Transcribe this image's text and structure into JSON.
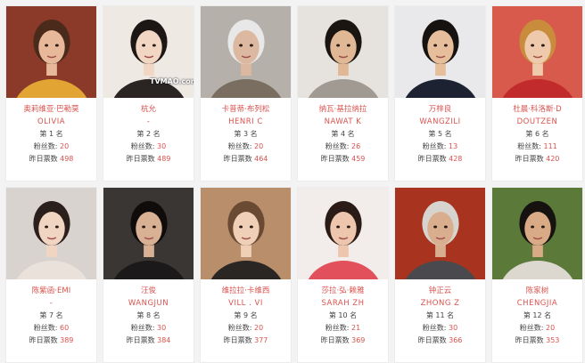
{
  "cards": [
    {
      "name_cn": "奥莉维亚·巴勒莫",
      "name_en": "OLIVIA",
      "rank": "第 1 名",
      "fans_label": "粉丝数:",
      "fans": "20",
      "votes_label": "昨日票数",
      "votes": "498",
      "palette": {
        "bg": "#8b3a2a",
        "skin": "#e7b89a",
        "hair": "#4a2a1a",
        "cloth": "#e2a534"
      }
    },
    {
      "name_cn": "杭允",
      "name_en": "-",
      "rank": "第 2 名",
      "fans_label": "粉丝数:",
      "fans": "30",
      "votes_label": "昨日票数",
      "votes": "489",
      "watermark": "TVMAO.com",
      "palette": {
        "bg": "#efe9e4",
        "skin": "#f2d6c4",
        "hair": "#1c1714",
        "cloth": "#2a2523"
      }
    },
    {
      "name_cn": "卡普蒂·布列松",
      "name_en": "HENRI C",
      "rank": "第 3 名",
      "fans_label": "粉丝数:",
      "fans": "20",
      "votes_label": "昨日票数",
      "votes": "464",
      "palette": {
        "bg": "#b5b1aa",
        "skin": "#dcb8a0",
        "hair": "#e8e8e8",
        "cloth": "#7a6e60"
      }
    },
    {
      "name_cn": "纳瓦·基拉纳拉",
      "name_en": "NAWAT K",
      "rank": "第 4 名",
      "fans_label": "粉丝数:",
      "fans": "26",
      "votes_label": "昨日票数",
      "votes": "459",
      "palette": {
        "bg": "#e6e2dd",
        "skin": "#e0b895",
        "hair": "#1b1512",
        "cloth": "#a09a93"
      }
    },
    {
      "name_cn": "万梓良",
      "name_en": "WANGZILI",
      "rank": "第 5 名",
      "fans_label": "粉丝数:",
      "fans": "13",
      "votes_label": "昨日票数",
      "votes": "428",
      "palette": {
        "bg": "#e9e9ec",
        "skin": "#e6be9c",
        "hair": "#15120f",
        "cloth": "#1d2233"
      }
    },
    {
      "name_cn": "杜晨·科洛斯·D",
      "name_en": "DOUTZEN",
      "rank": "第 6 名",
      "fans_label": "粉丝数:",
      "fans": "111",
      "votes_label": "昨日票数",
      "votes": "420",
      "palette": {
        "bg": "#d85a4d",
        "skin": "#efc9ab",
        "hair": "#c98c3c",
        "cloth": "#c22b2b"
      }
    },
    {
      "name_cn": "陈紫函·EMI",
      "name_en": "-",
      "rank": "第 7 名",
      "fans_label": "粉丝数:",
      "fans": "60",
      "votes_label": "昨日票数",
      "votes": "389",
      "palette": {
        "bg": "#d8d3cf",
        "skin": "#f1d5c3",
        "hair": "#2a1f1b",
        "cloth": "#e9e1da"
      }
    },
    {
      "name_cn": "汪俊",
      "name_en": "WANGJUN",
      "rank": "第 8 名",
      "fans_label": "粉丝数:",
      "fans": "30",
      "votes_label": "昨日票数",
      "votes": "384",
      "palette": {
        "bg": "#3a3634",
        "skin": "#d8b094",
        "hair": "#0f0c0b",
        "cloth": "#1b1919"
      }
    },
    {
      "name_cn": "维拉拉·卡维西",
      "name_en": "VILL . VI",
      "rank": "第 9 名",
      "fans_label": "粉丝数:",
      "fans": "20",
      "votes_label": "昨日票数",
      "votes": "377",
      "palette": {
        "bg": "#b98e6a",
        "skin": "#efcfb5",
        "hair": "#6b4a33",
        "cloth": "#2a2624"
      }
    },
    {
      "name_cn": "莎拉·弘·赖雅",
      "name_en": "SARAH ZH",
      "rank": "第 10 名",
      "fans_label": "粉丝数:",
      "fans": "21",
      "votes_label": "昨日票数",
      "votes": "369",
      "palette": {
        "bg": "#f2ecea",
        "skin": "#eec6ad",
        "hair": "#2a1b16",
        "cloth": "#e2505c"
      }
    },
    {
      "name_cn": "钟正云",
      "name_en": "ZHONG Z",
      "rank": "第 11 名",
      "fans_label": "粉丝数:",
      "fans": "30",
      "votes_label": "昨日票数",
      "votes": "366",
      "palette": {
        "bg": "#a8331e",
        "skin": "#d9ae8f",
        "hair": "#d7d4cf",
        "cloth": "#4a4a4e"
      }
    },
    {
      "name_cn": "陈家树",
      "name_en": "CHENGJIA",
      "rank": "第 12 名",
      "fans_label": "粉丝数:",
      "fans": "20",
      "votes_label": "昨日票数",
      "votes": "353",
      "palette": {
        "bg": "#5b7a3a",
        "skin": "#d8aa86",
        "hair": "#161210",
        "cloth": "#dcd7cf"
      }
    }
  ]
}
